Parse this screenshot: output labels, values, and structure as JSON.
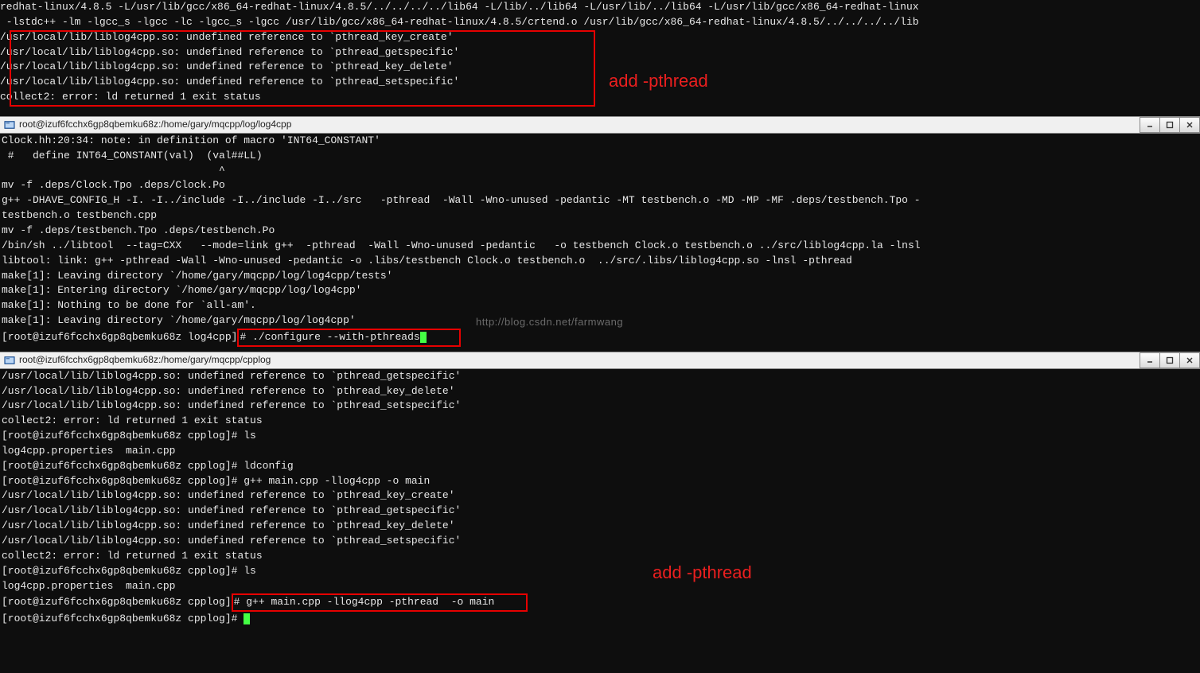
{
  "top": {
    "lines": [
      "redhat-linux/4.8.5 -L/usr/lib/gcc/x86_64-redhat-linux/4.8.5/../../../../lib64 -L/lib/../lib64 -L/usr/lib/../lib64 -L/usr/lib/gcc/x86_64-redhat-linux",
      " -lstdc++ -lm -lgcc_s -lgcc -lc -lgcc_s -lgcc /usr/lib/gcc/x86_64-redhat-linux/4.8.5/crtend.o /usr/lib/gcc/x86_64-redhat-linux/4.8.5/../../../../lib"
    ],
    "errors": [
      "/usr/local/lib/liblog4cpp.so: undefined reference to `pthread_key_create'",
      "/usr/local/lib/liblog4cpp.so: undefined reference to `pthread_getspecific'",
      "/usr/local/lib/liblog4cpp.so: undefined reference to `pthread_key_delete'",
      "/usr/local/lib/liblog4cpp.so: undefined reference to `pthread_setspecific'",
      "collect2: error: ld returned 1 exit status"
    ],
    "annot": "add -pthread"
  },
  "window1": {
    "title": "root@izuf6fcchx6gp8qbemku68z:/home/gary/mqcpp/log/log4cpp",
    "lines": [
      "Clock.hh:20:34: note: in definition of macro 'INT64_CONSTANT'",
      " #   define INT64_CONSTANT(val)  (val##LL)",
      "                                   ^",
      "mv -f .deps/Clock.Tpo .deps/Clock.Po",
      "g++ -DHAVE_CONFIG_H -I. -I../include -I../include -I../src   -pthread  -Wall -Wno-unused -pedantic -MT testbench.o -MD -MP -MF .deps/testbench.Tpo -",
      "testbench.o testbench.cpp",
      "mv -f .deps/testbench.Tpo .deps/testbench.Po",
      "/bin/sh ../libtool  --tag=CXX   --mode=link g++  -pthread  -Wall -Wno-unused -pedantic   -o testbench Clock.o testbench.o ../src/liblog4cpp.la -lnsl",
      "libtool: link: g++ -pthread -Wall -Wno-unused -pedantic -o .libs/testbench Clock.o testbench.o  ../src/.libs/liblog4cpp.so -lnsl -pthread",
      "make[1]: Leaving directory `/home/gary/mqcpp/log/log4cpp/tests'",
      "make[1]: Entering directory `/home/gary/mqcpp/log/log4cpp'",
      "make[1]: Nothing to be done for `all-am'.",
      "make[1]: Leaving directory `/home/gary/mqcpp/log/log4cpp'"
    ],
    "prompt": "[root@izuf6fcchx6gp8qbemku68z log4cpp]",
    "cmd": "# ./configure --with-pthreads",
    "watermark": "http://blog.csdn.net/farmwang"
  },
  "window2": {
    "title": "root@izuf6fcchx6gp8qbemku68z:/home/gary/mqcpp/cpplog",
    "lines": [
      "/usr/local/lib/liblog4cpp.so: undefined reference to `pthread_getspecific'",
      "/usr/local/lib/liblog4cpp.so: undefined reference to `pthread_key_delete'",
      "/usr/local/lib/liblog4cpp.so: undefined reference to `pthread_setspecific'",
      "collect2: error: ld returned 1 exit status",
      "[root@izuf6fcchx6gp8qbemku68z cpplog]# ls",
      "log4cpp.properties  main.cpp",
      "[root@izuf6fcchx6gp8qbemku68z cpplog]# ldconfig",
      "[root@izuf6fcchx6gp8qbemku68z cpplog]# g++ main.cpp -llog4cpp -o main",
      "/usr/local/lib/liblog4cpp.so: undefined reference to `pthread_key_create'",
      "/usr/local/lib/liblog4cpp.so: undefined reference to `pthread_getspecific'",
      "/usr/local/lib/liblog4cpp.so: undefined reference to `pthread_key_delete'",
      "/usr/local/lib/liblog4cpp.so: undefined reference to `pthread_setspecific'",
      "collect2: error: ld returned 1 exit status",
      "[root@izuf6fcchx6gp8qbemku68z cpplog]# ls",
      "log4cpp.properties  main.cpp"
    ],
    "prompt": "[root@izuf6fcchx6gp8qbemku68z cpplog]",
    "cmd": "# g++ main.cpp -llog4cpp -pthread  -o main",
    "next_prompt": "[root@izuf6fcchx6gp8qbemku68z cpplog]# ",
    "annot": "add -pthread"
  }
}
